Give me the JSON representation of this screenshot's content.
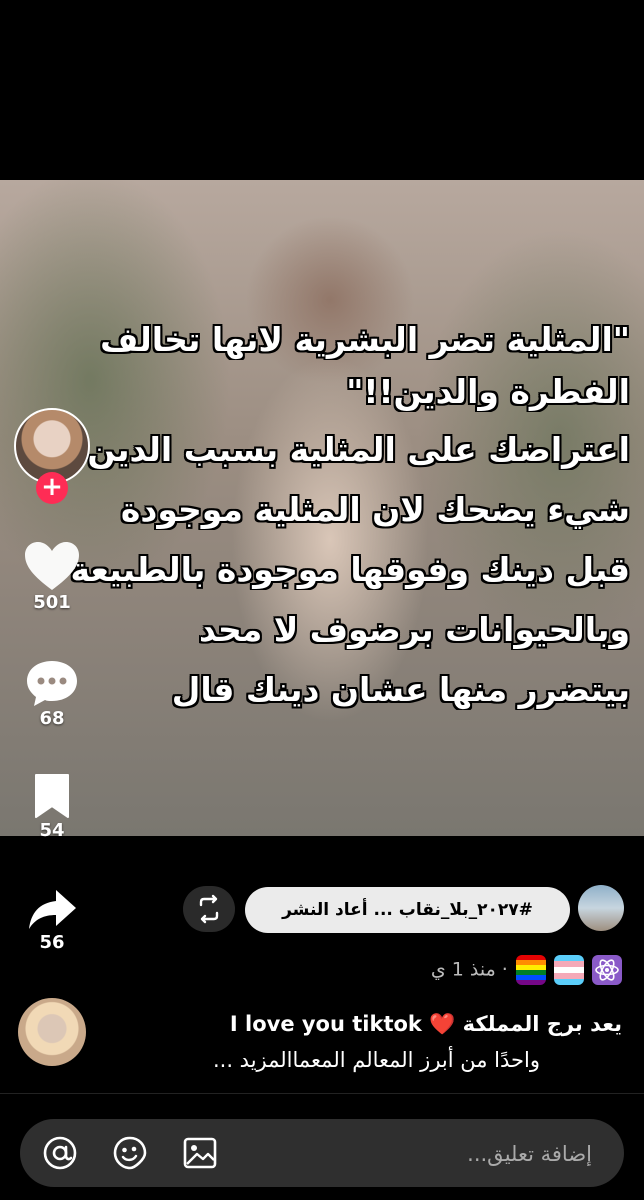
{
  "overlay": {
    "lines": [
      "\"المثلية تضر البشرية لانها تخالف",
      "الفطرة والدين!!\"",
      "اعتراضك على المثلية بسبب الدين",
      "شيء يضحك لان المثلية موجودة",
      "قبل دينك وفوقها موجودة بالطبيعة",
      "وبالحيوانات برضوف لا محد",
      "بيتضرر منها عشان دينك قال"
    ]
  },
  "actions": {
    "follow_symbol": "+",
    "likes": "501",
    "comments": "68",
    "saves": "54",
    "shares": "56"
  },
  "repost": {
    "label": "#٢٠٢٧_بلا_نقاب ... أعاد النشر"
  },
  "meta": {
    "time": "· منذ 1 ي"
  },
  "comment": {
    "line1": "يعد برج المملكة ❤️ I love you tiktok",
    "line2": "واحدًا من أبرز المعالم المعماالمزيد ..."
  },
  "comment_bar": {
    "placeholder": "إضافة تعليق..."
  },
  "icons": {
    "follow": "plus-icon",
    "like": "heart-icon",
    "comment": "speech-bubble-icon",
    "save": "bookmark-icon",
    "share": "share-arrow-icon",
    "repost": "repost-icon",
    "mention": "at-icon",
    "emoji": "emoji-icon",
    "image": "image-icon"
  },
  "colors": {
    "follow": "#fe2c55",
    "background": "#000000",
    "pill": "#ebebeb"
  }
}
